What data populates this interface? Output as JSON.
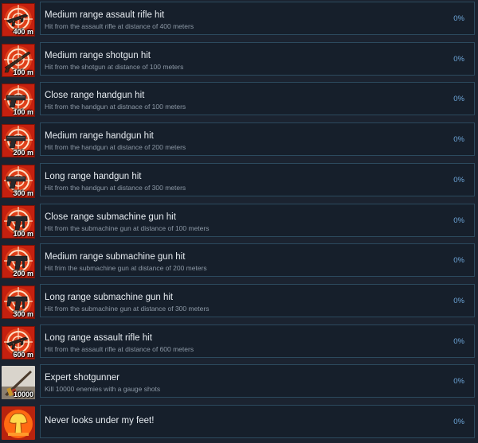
{
  "achievements": [
    {
      "title": "Medium range assault rifle hit",
      "description": "Hit from the assault rifle at distance of 400 meters",
      "percent": "0%",
      "badge": "400 m",
      "icon": "assault-rifle-target-icon"
    },
    {
      "title": "Medium range shotgun hit",
      "description": "Hit from the shotgun at distance of 100 meters",
      "percent": "0%",
      "badge": "100 m",
      "icon": "shotgun-target-icon"
    },
    {
      "title": "Close range handgun hit",
      "description": "Hit from the handgun at distnace of 100 meters",
      "percent": "0%",
      "badge": "100 m",
      "icon": "handgun-target-icon"
    },
    {
      "title": "Medium range handgun hit",
      "description": "Hit from the handgun at distance of 200 meters",
      "percent": "0%",
      "badge": "200 m",
      "icon": "handgun-target-icon"
    },
    {
      "title": "Long range handgun hit",
      "description": "Hit from the handgun at distance of 300 meters",
      "percent": "0%",
      "badge": "300 m",
      "icon": "handgun-target-icon"
    },
    {
      "title": "Close range submachine gun hit",
      "description": "Hit from the submachine gun at distance of 100 meters",
      "percent": "0%",
      "badge": "100 m",
      "icon": "submachine-gun-target-icon"
    },
    {
      "title": "Medium range submachine gun hit",
      "description": "Hit frim the submachine gun at distance of 200 meters",
      "percent": "0%",
      "badge": "200 m",
      "icon": "submachine-gun-target-icon"
    },
    {
      "title": "Long range submachine gun hit",
      "description": "Hit from the submachine gun at distance of 300 meters",
      "percent": "0%",
      "badge": "300 m",
      "icon": "submachine-gun-target-icon"
    },
    {
      "title": "Long range assault rifle hit",
      "description": "Hit from the assault rifle at distance of 600 meters",
      "percent": "0%",
      "badge": "600 m",
      "icon": "assault-rifle-target-icon"
    },
    {
      "title": "Expert shotgunner",
      "description": "Kill 10000 enemies with a gauge shots",
      "percent": "0%",
      "badge": "10000",
      "icon": "shotgun-shells-icon"
    },
    {
      "title": "Never looks under my feet!",
      "description": "",
      "percent": "0%",
      "badge": "",
      "icon": "explosion-icon"
    }
  ],
  "colors": {
    "background": "#1b2330",
    "panel": "#161f2b",
    "panel_border": "#2c4a5e",
    "title": "#e7ecf1",
    "description": "#8d99a6",
    "percent": "#6fa8dc",
    "icon_red": "#c4200f",
    "icon_orange": "#ff8a1c"
  }
}
